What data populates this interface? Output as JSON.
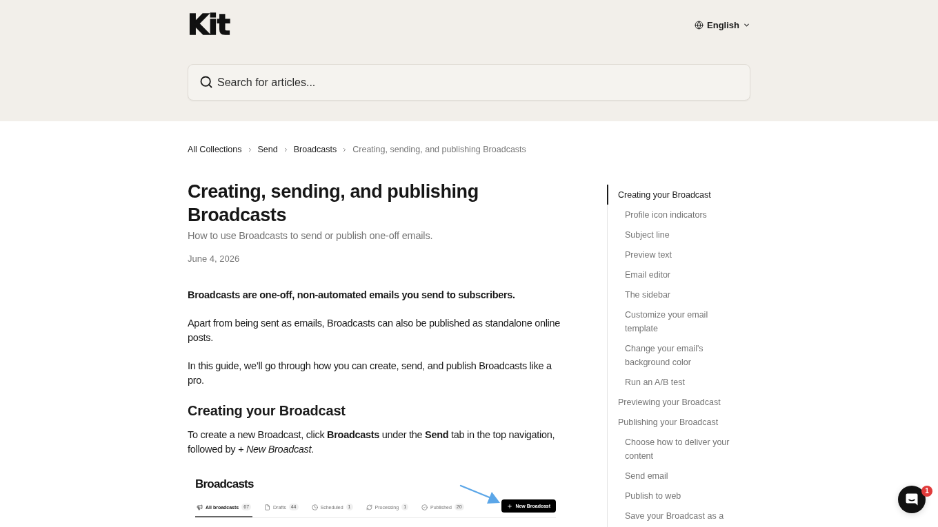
{
  "header": {
    "logo": "Kit",
    "language": "English",
    "search": {
      "placeholder": "Search for articles..."
    }
  },
  "breadcrumbs": {
    "links": [
      "All Collections",
      "Send",
      "Broadcasts"
    ],
    "current": "Creating, sending, and publishing Broadcasts"
  },
  "article": {
    "title": "Creating, sending, and publishing Broadcasts",
    "subtitle": "How to use Broadcasts to send or publish one-off emails.",
    "date": "June 4, 2026",
    "blocks": [
      {
        "kind": "lead",
        "text": "Broadcasts are one-off, non-automated emails you send to subscribers."
      },
      {
        "kind": "paragraph",
        "text": "Apart from being sent as emails, Broadcasts can also be published as standalone online posts."
      },
      {
        "kind": "paragraph",
        "text": "In this guide, we’ll go through how you can create, send, and publish Broadcasts like a pro."
      },
      {
        "kind": "heading",
        "text": "Creating your Broadcast"
      },
      {
        "kind": "paragraph",
        "text": "To create a new Broadcast, click **Broadcasts** under the **Send** tab in the top navigation, followed by *+ New Broadcast*."
      },
      {
        "kind": "screenshot",
        "title": "Broadcasts",
        "tabs": [
          {
            "label": "All broadcasts",
            "count": "67",
            "selected": true
          },
          {
            "label": "Drafts",
            "count": "44",
            "selected": false
          },
          {
            "label": "Scheduled",
            "count": "1",
            "selected": false
          },
          {
            "label": "Processing",
            "count": "1",
            "selected": false
          },
          {
            "label": "Published",
            "count": "20",
            "selected": false
          }
        ],
        "button": "New Broadcast"
      }
    ]
  },
  "toc": [
    {
      "label": "Creating your Broadcast",
      "selected": true,
      "children": [
        {
          "label": "Profile icon indicators",
          "selected": false
        },
        {
          "label": "Subject line",
          "selected": false
        },
        {
          "label": "Preview text",
          "selected": false
        },
        {
          "label": "Email editor",
          "selected": false
        },
        {
          "label": "The sidebar",
          "selected": false
        },
        {
          "label": "Customize your email template",
          "selected": false
        },
        {
          "label": "Change your email's background color",
          "selected": false
        },
        {
          "label": "Run an A/B test",
          "selected": false
        }
      ]
    },
    {
      "label": "Previewing your Broadcast",
      "selected": false
    },
    {
      "label": "Publishing your Broadcast",
      "selected": false,
      "children": [
        {
          "label": "Choose how to deliver your content",
          "selected": false
        },
        {
          "label": "Send email",
          "selected": false
        },
        {
          "label": "Publish to web",
          "selected": false
        },
        {
          "label": "Save your Broadcast as a",
          "selected": false
        }
      ]
    }
  ],
  "chat": {
    "unread": "1"
  }
}
